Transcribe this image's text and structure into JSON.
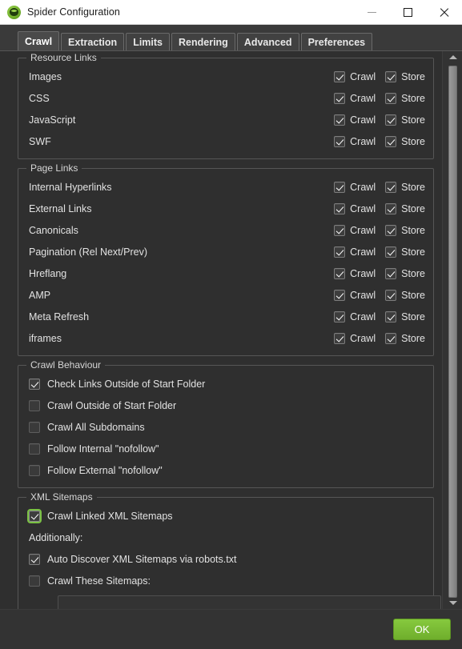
{
  "window": {
    "title": "Spider Configuration",
    "icon": "spider-frog-icon",
    "minimize_label": "–",
    "maximize_label": "□",
    "close_label": "×"
  },
  "tabs": [
    {
      "label": "Crawl",
      "active": true
    },
    {
      "label": "Extraction",
      "active": false
    },
    {
      "label": "Limits",
      "active": false
    },
    {
      "label": "Rendering",
      "active": false
    },
    {
      "label": "Advanced",
      "active": false
    },
    {
      "label": "Preferences",
      "active": false
    }
  ],
  "column_labels": {
    "crawl": "Crawl",
    "store": "Store"
  },
  "groups": {
    "resource_links": {
      "title": "Resource Links",
      "rows": [
        {
          "label": "Images",
          "crawl": true,
          "store": true
        },
        {
          "label": "CSS",
          "crawl": true,
          "store": true
        },
        {
          "label": "JavaScript",
          "crawl": true,
          "store": true
        },
        {
          "label": "SWF",
          "crawl": true,
          "store": true
        }
      ]
    },
    "page_links": {
      "title": "Page Links",
      "rows": [
        {
          "label": "Internal Hyperlinks",
          "crawl": true,
          "store": true
        },
        {
          "label": "External Links",
          "crawl": true,
          "store": true
        },
        {
          "label": "Canonicals",
          "crawl": true,
          "store": true
        },
        {
          "label": "Pagination (Rel Next/Prev)",
          "crawl": true,
          "store": true
        },
        {
          "label": "Hreflang",
          "crawl": true,
          "store": true
        },
        {
          "label": "AMP",
          "crawl": true,
          "store": true
        },
        {
          "label": "Meta Refresh",
          "crawl": true,
          "store": true
        },
        {
          "label": "iframes",
          "crawl": true,
          "store": true
        }
      ]
    },
    "crawl_behaviour": {
      "title": "Crawl Behaviour",
      "rows": [
        {
          "label": "Check Links Outside of Start Folder",
          "checked": true
        },
        {
          "label": "Crawl Outside of Start Folder",
          "checked": false
        },
        {
          "label": "Crawl All Subdomains",
          "checked": false
        },
        {
          "label": "Follow Internal \"nofollow\"",
          "checked": false
        },
        {
          "label": "Follow External \"nofollow\"",
          "checked": false
        }
      ]
    },
    "xml_sitemaps": {
      "title": "XML Sitemaps",
      "crawl_linked": {
        "label": "Crawl Linked XML Sitemaps",
        "checked": true,
        "focused": true
      },
      "additionally_label": "Additionally:",
      "auto_discover": {
        "label": "Auto Discover XML Sitemaps via robots.txt",
        "checked": true
      },
      "crawl_these": {
        "label": "Crawl These Sitemaps:",
        "checked": false
      },
      "sitemap_list_value": ""
    }
  },
  "footer": {
    "ok_label": "OK"
  },
  "colors": {
    "accent_green": "#7ac143",
    "panel_bg": "#2f2f2f",
    "titlebar_bg": "#ffffff",
    "text": "#e2e2e2",
    "group_border": "#565656"
  }
}
